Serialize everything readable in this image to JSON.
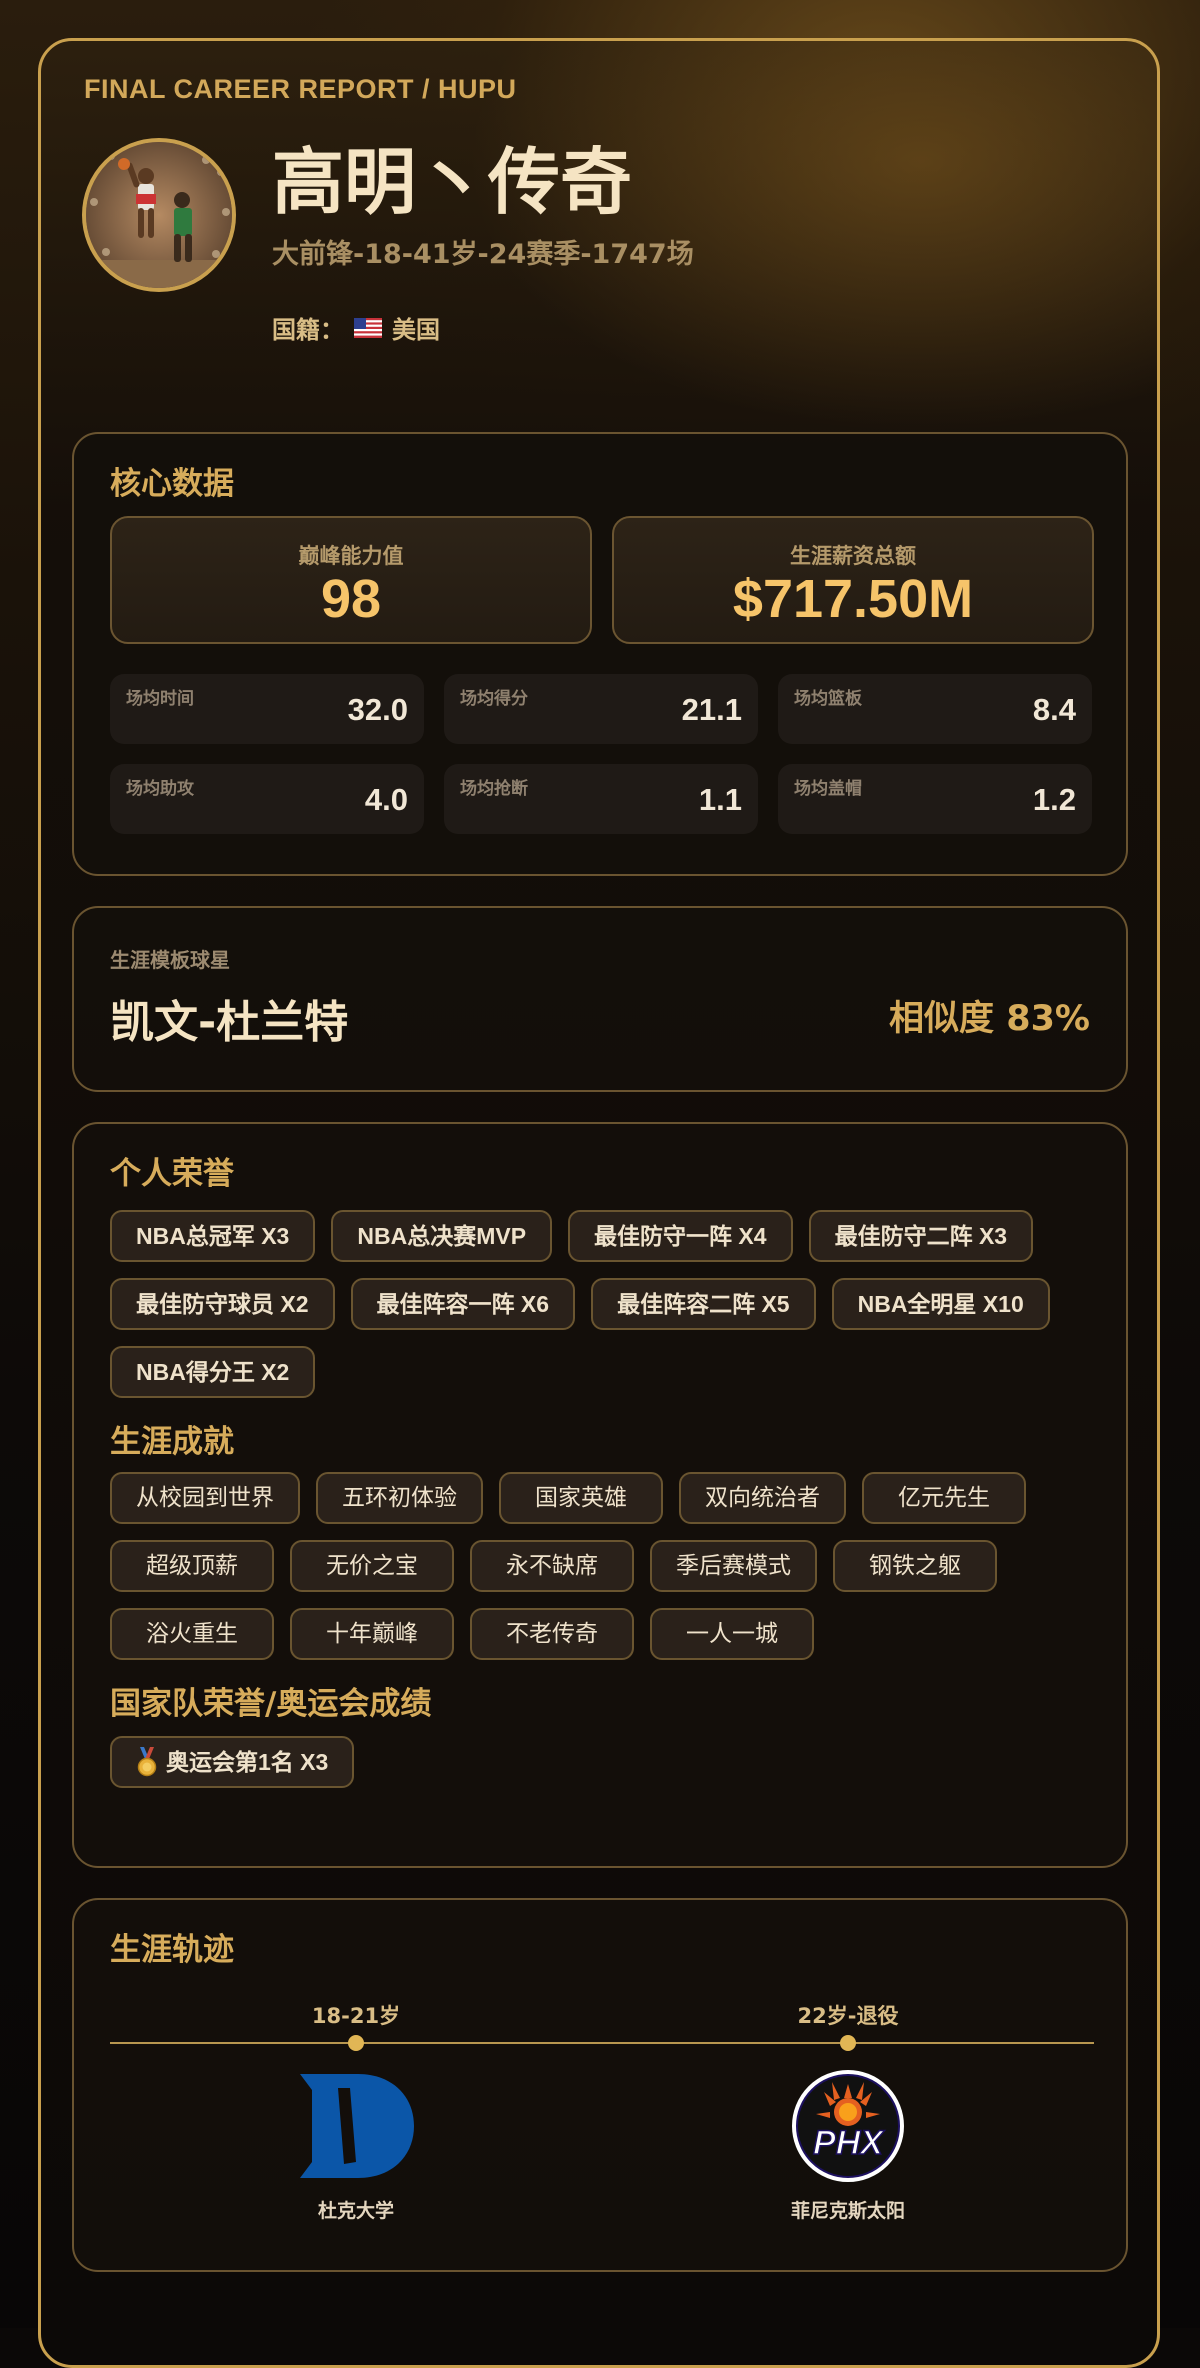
{
  "header": {
    "brand": "FINAL CAREER REPORT / HUPU",
    "player_name": "高明丶传奇",
    "subtitle": "大前锋-18-41岁-24赛季-1747场",
    "nationality_label": "国籍：",
    "nationality": "美国",
    "flag_icon": "us-flag-icon"
  },
  "core": {
    "title": "核心数据",
    "peak_label": "巅峰能力值",
    "peak_value": "98",
    "salary_label": "生涯薪资总额",
    "salary_value": "$717.50M",
    "stats": [
      {
        "label": "场均时间",
        "value": "32.0"
      },
      {
        "label": "场均得分",
        "value": "21.1"
      },
      {
        "label": "场均篮板",
        "value": "8.4"
      },
      {
        "label": "场均助攻",
        "value": "4.0"
      },
      {
        "label": "场均抢断",
        "value": "1.1"
      },
      {
        "label": "场均盖帽",
        "value": "1.2"
      }
    ]
  },
  "template": {
    "label": "生涯模板球星",
    "player": "凯文-杜兰特",
    "similarity": "相似度 83%"
  },
  "honors": {
    "title": "个人荣誉",
    "items": [
      "NBA总冠军 X3",
      "NBA总决赛MVP",
      "最佳防守一阵 X4",
      "最佳防守二阵 X3",
      "最佳防守球员 X2",
      "最佳阵容一阵 X6",
      "最佳阵容二阵 X5",
      "NBA全明星 X10",
      "NBA得分王 X2"
    ]
  },
  "achievements": {
    "title": "生涯成就",
    "items": [
      "从校园到世界",
      "五环初体验",
      "国家英雄",
      "双向统治者",
      "亿元先生",
      "超级顶薪",
      "无价之宝",
      "永不缺席",
      "季后赛模式",
      "钢铁之躯",
      "浴火重生",
      "十年巅峰",
      "不老传奇",
      "一人一城"
    ]
  },
  "national": {
    "title": "国家队荣誉/奥运会成绩",
    "items": [
      {
        "icon": "gold-medal-icon",
        "label": "奥运会第1名 X3"
      }
    ]
  },
  "trajectory": {
    "title": "生涯轨迹",
    "stops": [
      {
        "age": "18-21岁",
        "team": "杜克大学",
        "logo": "duke-logo-icon"
      },
      {
        "age": "22岁-退役",
        "team": "菲尼克斯太阳",
        "logo": "phx-suns-logo-icon",
        "logo_text": "PHX"
      }
    ]
  },
  "colors": {
    "accent": "#d7ac5b",
    "border": "#c9a04e",
    "value": "#f6c46a"
  }
}
